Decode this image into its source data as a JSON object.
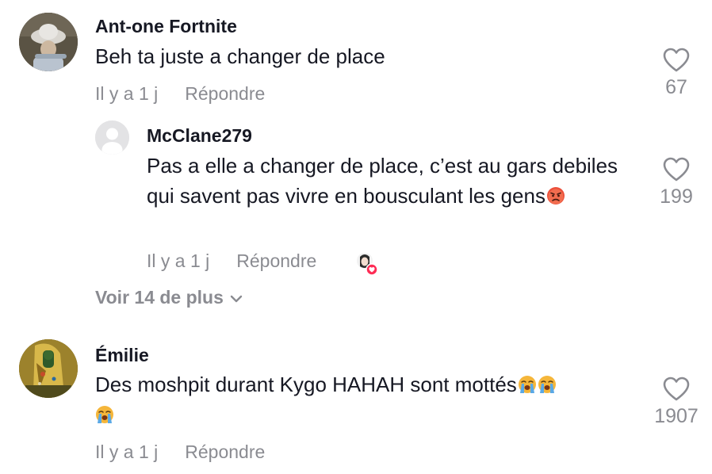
{
  "comments": [
    {
      "username": "Ant-one Fortnite",
      "text": "Beh ta juste a changer de place",
      "time": "Il y a 1 j",
      "reply_label": "Répondre",
      "likes": "67",
      "avatar_icon": "user-photo-avatar"
    },
    {
      "username": "McClane279",
      "text": "Pas a elle a changer de place, c’est au gars debiles qui savent pas vivre en bousculant les gens",
      "emoji": "angry-face-emoji",
      "time": "Il y a 1 j",
      "reply_label": "Répondre",
      "likes": "199",
      "avatar_icon": "default-user-avatar",
      "creator_liked_icon": "creator-liked-heart-icon"
    },
    {
      "username": "Émilie",
      "text": "Des moshpit durant Kygo HAHAH sont mottés",
      "emoji": "loudly-crying-face-emoji",
      "time": "Il y a 1 j",
      "reply_label": "Répondre",
      "likes": "1907",
      "avatar_icon": "painting-avatar"
    }
  ],
  "view_more": {
    "label": "Voir 14 de plus",
    "icon": "chevron-down-icon"
  },
  "colors": {
    "text": "#161823",
    "muted": "#8a8b91",
    "like_badge": "#fe2c55",
    "emoji": "#f5a623"
  }
}
